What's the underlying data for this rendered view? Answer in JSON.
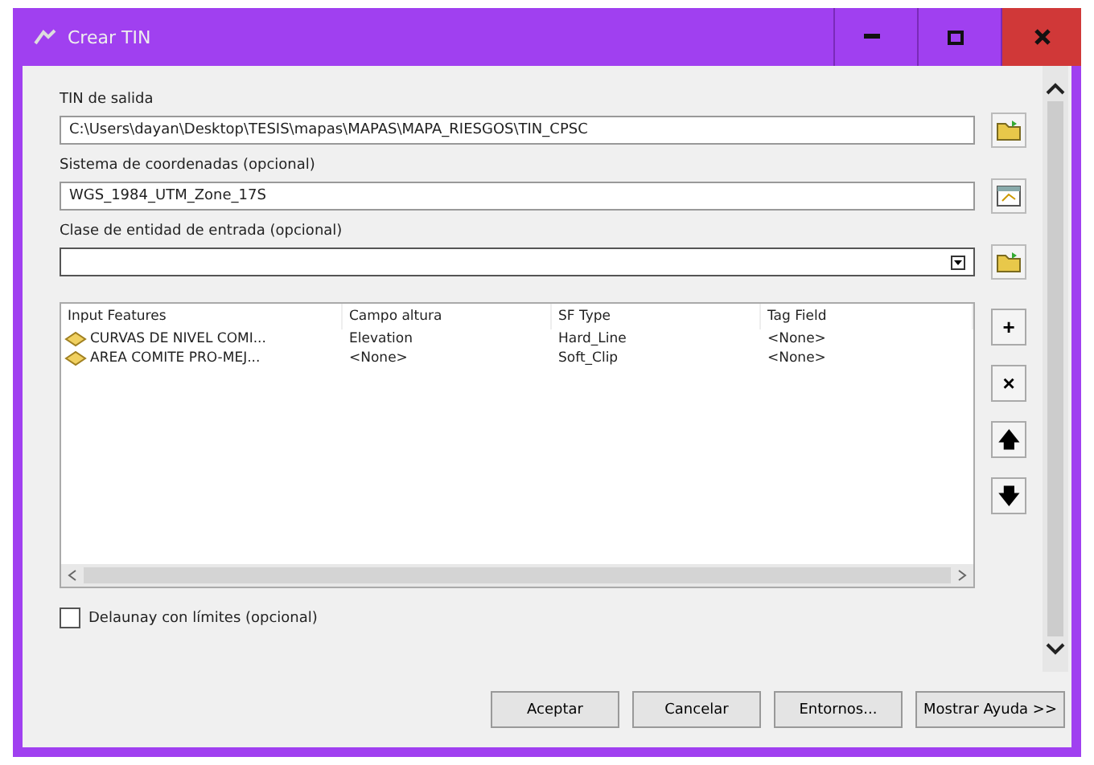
{
  "window": {
    "title": "Crear TIN"
  },
  "fields": [
    {
      "label": "TIN de salida",
      "value": "C:\\Users\\dayan\\Desktop\\TESIS\\mapas\\MAPAS\\MAPA_RIESGOS\\TIN_CPSC",
      "kind": "path"
    },
    {
      "label": "Sistema de coordenadas (opcional)",
      "value": "WGS_1984_UTM_Zone_17S",
      "kind": "coords"
    },
    {
      "label": "Clase de entidad de entrada (opcional)",
      "kind": "dropdown"
    }
  ],
  "table": {
    "columns": [
      "Input Features",
      "Campo altura",
      "SF Type",
      "Tag Field"
    ],
    "rows": [
      [
        "CURVAS DE NIVEL COMI...",
        "Elevation",
        "Hard_Line",
        "<None>"
      ],
      [
        "AREA COMITE PRO-MEJ...",
        "<None>",
        "Soft_Clip",
        "<None>"
      ]
    ]
  },
  "side_buttons": [
    "+",
    "×",
    "🡅",
    "🡇"
  ],
  "checkbox": {
    "label": "Delaunay con límites (opcional)",
    "checked": false
  },
  "buttons": [
    "Aceptar",
    "Cancelar",
    "Entornos...",
    "Mostrar Ayuda >>"
  ]
}
